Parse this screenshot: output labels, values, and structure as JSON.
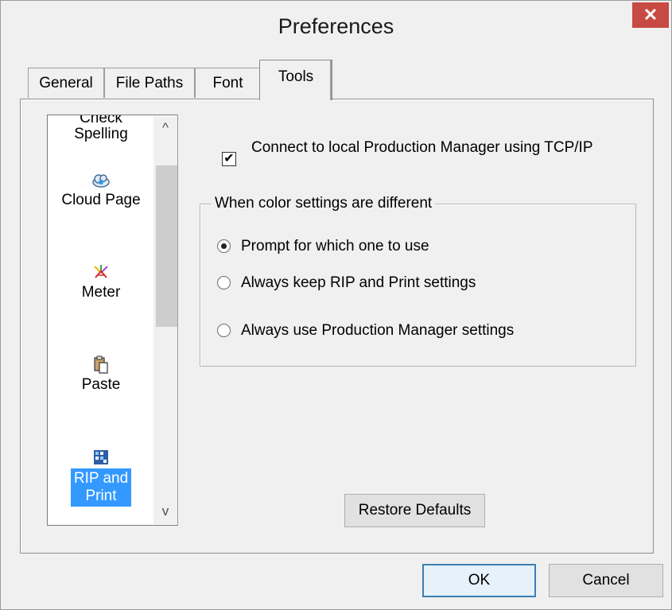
{
  "window": {
    "title": "Preferences",
    "close_icon": "✕"
  },
  "tabs": [
    {
      "label": "General"
    },
    {
      "label": "File Paths"
    },
    {
      "label": "Font"
    },
    {
      "label": "Tools",
      "active": true
    }
  ],
  "tool_list": {
    "items": [
      {
        "label": "Check\nSpelling",
        "icon": "spellcheck-icon"
      },
      {
        "label": "Cloud Page",
        "icon": "cloud-icon"
      },
      {
        "label": "Meter",
        "icon": "meter-icon"
      },
      {
        "label": "Paste",
        "icon": "paste-icon"
      },
      {
        "label": "RIP and\nPrint",
        "icon": "rip-print-icon",
        "selected": true
      }
    ],
    "scroll_up_icon": "^",
    "scroll_down_icon": "v"
  },
  "connect_checkbox": {
    "checked": true,
    "label": "Connect to local Production Manager using TCP/IP"
  },
  "color_settings": {
    "legend": "When color settings are different",
    "options": [
      {
        "label": "Prompt for which one to use",
        "selected": true
      },
      {
        "label": "Always keep RIP and Print settings",
        "selected": false
      },
      {
        "label": "Always use Production Manager settings",
        "selected": false
      }
    ]
  },
  "buttons": {
    "restore_defaults": "Restore Defaults",
    "ok": "OK",
    "cancel": "Cancel"
  }
}
